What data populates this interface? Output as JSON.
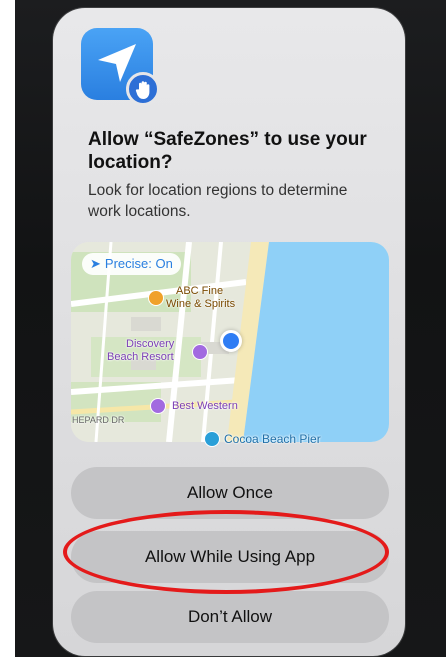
{
  "dialog": {
    "title": "Allow “SafeZones” to use your location?",
    "message": "Look for location regions to determine work locations.",
    "app_icon": "location-arrow-icon",
    "badge_icon": "raised-hand-icon"
  },
  "map": {
    "precise_label": "Precise: On",
    "places": {
      "abc_line1": "ABC Fine",
      "abc_line2": "Wine & Spirits",
      "discovery_line1": "Discovery",
      "discovery_line2": "Beach Resort",
      "best_western": "Best Western",
      "cocoa_pier": "Cocoa Beach Pier",
      "street": "HEPARD DR"
    }
  },
  "buttons": {
    "allow_once": "Allow Once",
    "allow_while_using": "Allow While Using App",
    "dont_allow": "Don’t Allow"
  },
  "colors": {
    "accent": "#2a7fe0",
    "highlight_ring": "#e41a1a",
    "ocean": "#8fd0f7"
  }
}
